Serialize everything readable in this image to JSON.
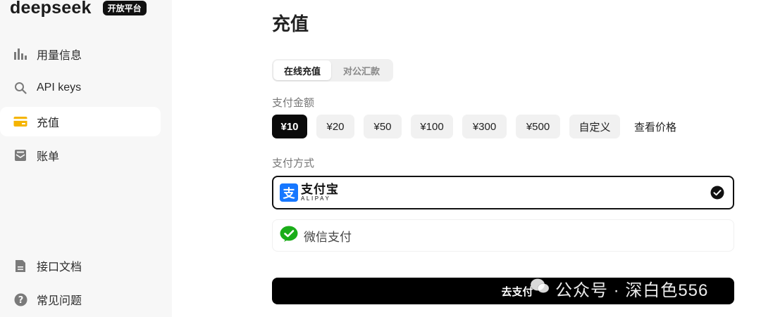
{
  "brand": {
    "logo_text": "deepseek",
    "badge": "开放平台"
  },
  "sidebar": {
    "items": [
      {
        "label": "用量信息",
        "icon": "bar-chart-icon"
      },
      {
        "label": "API keys",
        "icon": "search-icon"
      },
      {
        "label": "充值",
        "icon": "card-icon",
        "active": true
      },
      {
        "label": "账单",
        "icon": "envelope-icon"
      }
    ],
    "bottom_items": [
      {
        "label": "接口文档",
        "icon": "document-icon"
      },
      {
        "label": "常见问题",
        "icon": "help-icon"
      }
    ]
  },
  "main": {
    "title": "充值",
    "tabs": [
      {
        "label": "在线充值",
        "active": true
      },
      {
        "label": "对公汇款",
        "active": false
      }
    ],
    "amount_label": "支付金额",
    "amounts": [
      "¥10",
      "¥20",
      "¥50",
      "¥100",
      "¥300",
      "¥500",
      "自定义"
    ],
    "selected_amount": "¥10",
    "price_link": "查看价格",
    "method_label": "支付方式",
    "methods": {
      "alipay_cn": "支付宝",
      "alipay_en": "ALIPAY",
      "wechat": "微信支付"
    },
    "selected_method": "alipay",
    "pay_button": "去支付"
  },
  "watermark": {
    "text": "公众号 · 深白色556"
  },
  "colors": {
    "accent": "#000000",
    "alipay": "#1677ff",
    "wechat": "#1aad19",
    "sidebar_bg": "#f7f7f7",
    "active_icon": "#f5b400"
  }
}
